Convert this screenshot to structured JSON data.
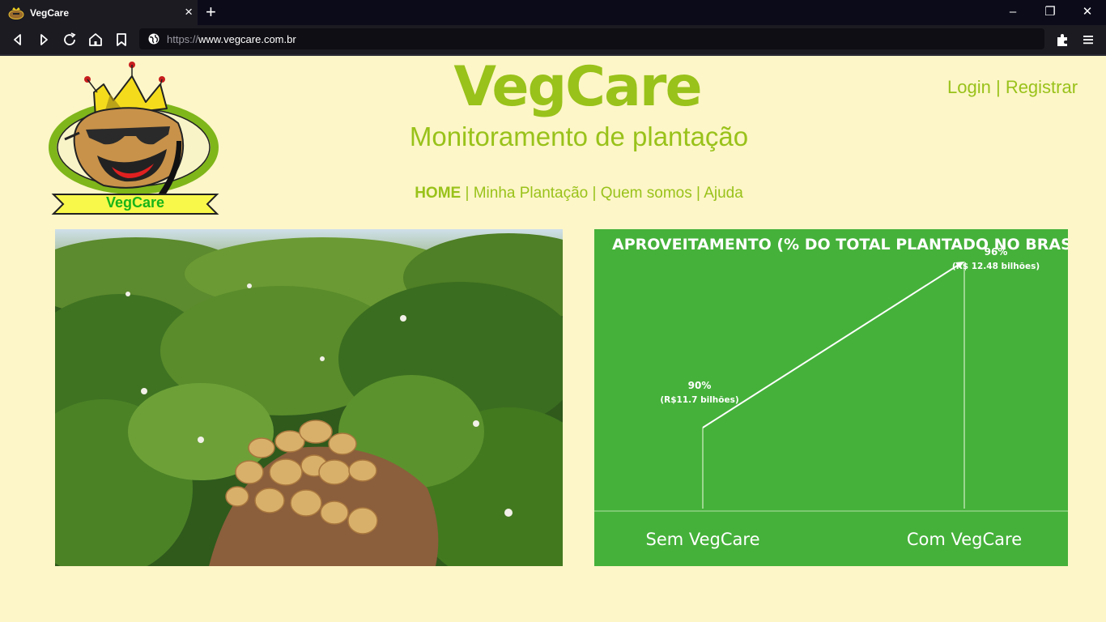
{
  "browser": {
    "tab_title": "VegCare",
    "tab_close": "×",
    "new_tab": "+",
    "url_prefix": "https://",
    "url_host": "www.vegcare.com.br",
    "window_controls": [
      "–",
      "❐",
      "✕"
    ]
  },
  "header": {
    "logo_caption": "VegCare",
    "title": "VegCare",
    "subtitle": "Monitoramento de plantação",
    "login": "Login",
    "separator": "|",
    "register": "Registrar"
  },
  "nav": {
    "items": [
      {
        "label": "HOME",
        "active": true
      },
      {
        "label": "Minha Plantação",
        "active": false
      },
      {
        "label": "Quem somos",
        "active": false
      },
      {
        "label": "Ajuda",
        "active": false
      }
    ],
    "separator": "|"
  },
  "colors": {
    "accent": "#99c21a",
    "chart_bg": "#45b13a",
    "page_bg": "#fdf6c8"
  },
  "chart_data": {
    "type": "line",
    "title": "APROVEITAMENTO (% DO TOTAL PLANTADO NO BRASIL)",
    "categories": [
      "Sem VegCare",
      "Com VegCare"
    ],
    "values": [
      90,
      96
    ],
    "value_labels": [
      "90%",
      "96%"
    ],
    "sub_labels": [
      "(R$11.7 bilhões)",
      "(R$ 12.48 bilhões)"
    ],
    "unit": "%"
  }
}
